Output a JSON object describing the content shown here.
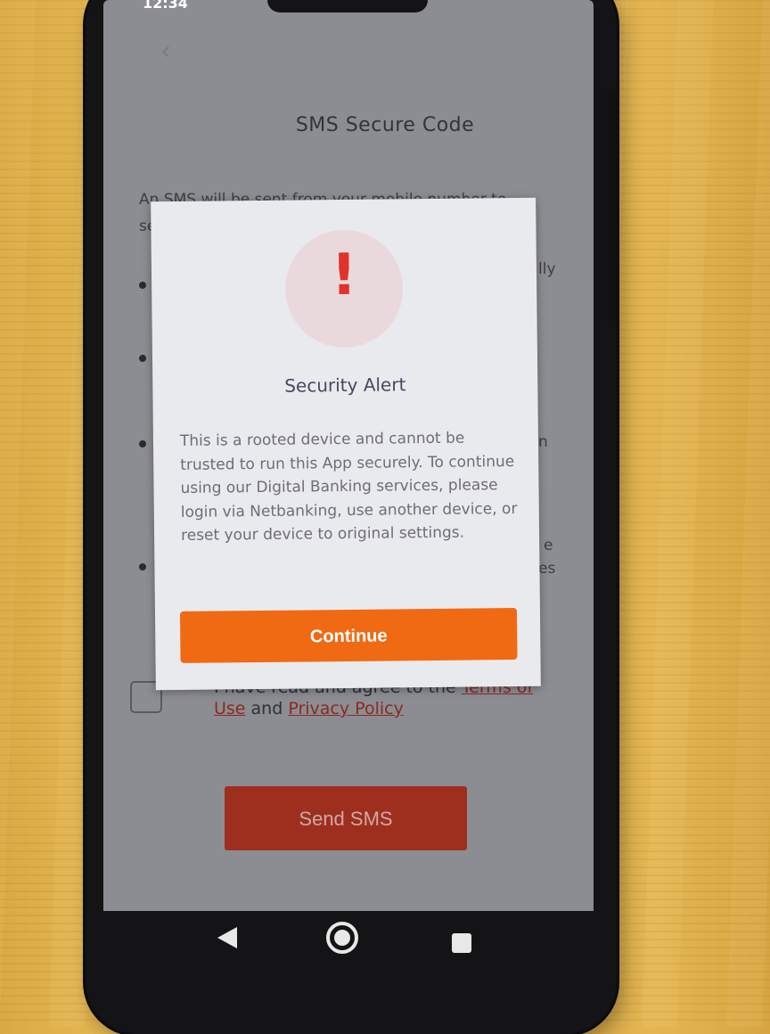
{
  "status_bar": {
    "time": "12:34"
  },
  "header": {
    "title": "SMS Secure Code"
  },
  "background": {
    "intro_line1": "An SMS will be sent from your mobile number to",
    "intro_line2": "se",
    "bullet1_tail": "lly",
    "bullet3_tail": "n",
    "bullet4_tail_1": "e",
    "bullet4_tail_2": "es"
  },
  "consent": {
    "prefix": "I have read and agree to the ",
    "terms_link_part1": "Terms of",
    "terms_link_part2": "Use",
    "connector": " and ",
    "privacy_link": "Privacy Policy"
  },
  "send_button": {
    "label": "Send SMS"
  },
  "dialog": {
    "icon": "exclamation-icon",
    "title": "Security Alert",
    "body": "This is a rooted device and cannot be trusted to run this App securely. To continue using our Digital Banking services, please login via Netbanking, use another device, or reset your device to original settings.",
    "button_label": "Continue",
    "accent_color": "#f06a14",
    "alert_color": "#e0332c"
  },
  "navigation": {
    "back_icon": "nav-back-icon",
    "home_icon": "nav-home-icon",
    "recents_icon": "nav-recents-icon"
  }
}
